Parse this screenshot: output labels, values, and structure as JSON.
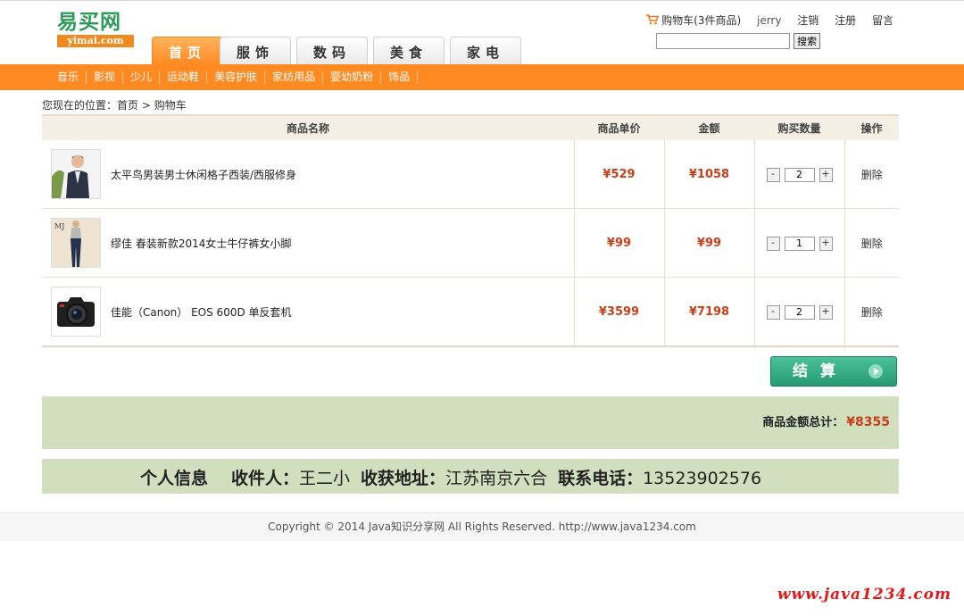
{
  "header": {
    "logo_cn": "易买网",
    "logo_en": "yimai.com",
    "nav_tabs": [
      "首页",
      "服饰",
      "数码",
      "美食",
      "家电"
    ],
    "top_links": {
      "cart": "购物车(3件商品)",
      "user": "jerry",
      "logout": "注销",
      "register": "注册",
      "message": "留言"
    },
    "search": {
      "value": "",
      "button": "搜索"
    }
  },
  "categories": [
    "音乐",
    "影视",
    "少儿",
    "运动鞋",
    "美容护肤",
    "家纺用品",
    "婴幼奶粉",
    "饰品"
  ],
  "breadcrumb": {
    "prefix": "您现在的位置：",
    "home": "首页",
    "sep": " > ",
    "current": "购物车"
  },
  "cart": {
    "columns": [
      "商品名称",
      "商品单价",
      "金额",
      "购买数量",
      "操作"
    ],
    "rows": [
      {
        "name": "太平鸟男装男士休闲格子西装/西服修身",
        "price": "¥529",
        "amount": "¥1058",
        "qty": "2",
        "action": "删除"
      },
      {
        "name": "缪佳 春装新款2014女士牛仔裤女小脚",
        "price": "¥99",
        "amount": "¥99",
        "qty": "1",
        "action": "删除"
      },
      {
        "name": "佳能（Canon） EOS 600D 单反套机",
        "price": "¥3599",
        "amount": "¥7198",
        "qty": "2",
        "action": "删除"
      }
    ],
    "qty_minus": "-",
    "qty_plus": "+"
  },
  "checkout": {
    "label": "结算"
  },
  "summary": {
    "label": "商品金额总计：",
    "total": "¥8355"
  },
  "personal_info": {
    "title": "个人信息",
    "receiver_label": "收件人：",
    "receiver": "王二小",
    "address_label": "收获地址：",
    "address": "江苏南京六合",
    "phone_label": "联系电话：",
    "phone": "13523902576"
  },
  "footer": {
    "text": "Copyright © 2014 Java知识分享网 All Rights Reserved. http://www.java1234.com"
  },
  "watermark": "www.java1234.com",
  "colors": {
    "accent": "#ff8a22",
    "brand_green": "#2e9a58",
    "price_red": "#c8401a",
    "panel_green": "#d2dfbe"
  }
}
